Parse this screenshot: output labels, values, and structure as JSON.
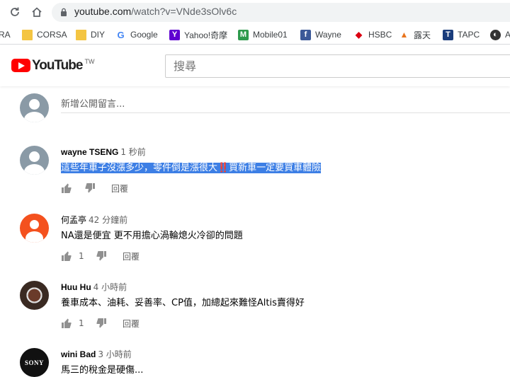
{
  "browser": {
    "url_host": "youtube.com",
    "url_path": "/watch?v=VNde3sOlv6c"
  },
  "bookmarks": [
    {
      "label": "RA",
      "icon": "none"
    },
    {
      "label": "CORSA",
      "icon": "folder-icon"
    },
    {
      "label": "DIY",
      "icon": "folder-icon"
    },
    {
      "label": "Google",
      "icon": "google-icon"
    },
    {
      "label": "Yahoo!奇摩",
      "icon": "yahoo-icon"
    },
    {
      "label": "Mobile01",
      "icon": "mobile01-icon"
    },
    {
      "label": "Wayne",
      "icon": "facebook-icon"
    },
    {
      "label": "HSBC",
      "icon": "hsbc-icon"
    },
    {
      "label": "露天",
      "icon": "ruten-icon"
    },
    {
      "label": "TAPC",
      "icon": "tapc-icon"
    },
    {
      "label": "A",
      "icon": "bookmark-icon"
    }
  ],
  "youtube": {
    "logo_text": "YouTube",
    "region": "TW",
    "search_placeholder": "搜尋"
  },
  "comments_section": {
    "add_placeholder": "新增公開留言...",
    "reply_label": "回覆",
    "comments": [
      {
        "author": "wayne TSENG",
        "time": "1 秒前",
        "text": "這些年車子沒漲多少，零件倒是漲很大‼️買新車一定要買車體險",
        "likes": "",
        "avatar": "default-gray",
        "selected": true
      },
      {
        "author": "何孟亭",
        "time": "42 分鐘前",
        "text": "NA還是便宜 更不用擔心渦輪熄火冷卻的問題",
        "likes": "1",
        "avatar": "default-orange",
        "selected": false
      },
      {
        "author": "Huu Hu",
        "time": "4 小時前",
        "text": "養車成本、油耗、妥善率、CP值，加總起來難怪Altis賣得好",
        "likes": "1",
        "avatar": "badge",
        "selected": false
      },
      {
        "author": "wini Bad",
        "time": "3 小時前",
        "text": "馬三的稅金是硬傷...",
        "likes": "",
        "avatar": "sony",
        "avatar_text": "SONY",
        "selected": false
      }
    ]
  }
}
